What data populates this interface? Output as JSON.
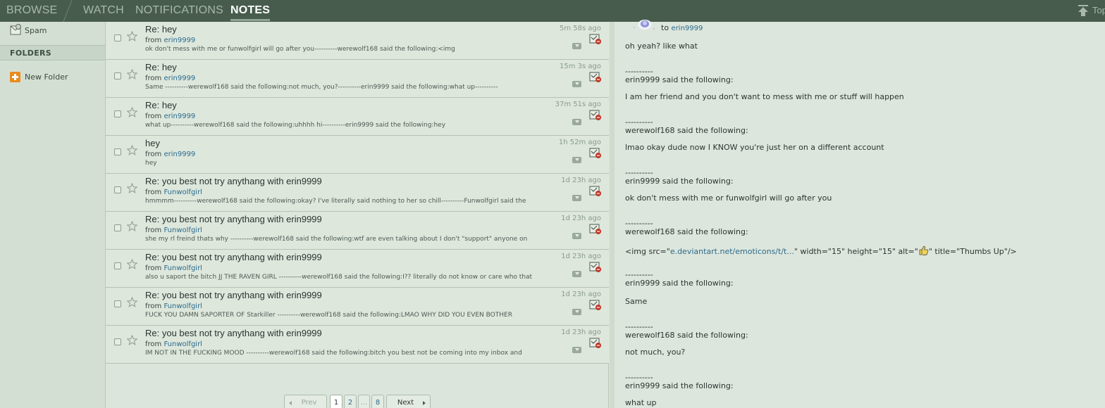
{
  "nav": {
    "tabs": [
      "BROWSE",
      "WATCH",
      "NOTIFICATIONS",
      "NOTES"
    ],
    "active_tab": "NOTES",
    "top_label": "Top"
  },
  "sidebar": {
    "spam_label": "Spam",
    "folders_header": "FOLDERS",
    "new_folder_label": "New Folder"
  },
  "messages": [
    {
      "subject": "Re: hey",
      "from_label": "from",
      "from": "erin9999",
      "time": "5m 58s ago",
      "preview": "ok don't mess with me or funwolfgirl will go after you----------werewolf168 said the following:<img"
    },
    {
      "subject": "Re: hey",
      "from_label": "from",
      "from": "erin9999",
      "time": "15m 3s ago",
      "preview": "Same ----------werewolf168 said the following:not much, you?----------erin9999 said the following:what up----------"
    },
    {
      "subject": "Re: hey",
      "from_label": "from",
      "from": "erin9999",
      "time": "37m 51s ago",
      "preview": "what up----------werewolf168 said the following:uhhhh hi----------erin9999 said the following:hey"
    },
    {
      "subject": "hey",
      "from_label": "from",
      "from": "erin9999",
      "time": "1h 52m ago",
      "preview": "hey"
    },
    {
      "subject": "Re: you best not try anythang with erin9999",
      "from_label": "from",
      "from": "Funwolfgirl",
      "time": "1d 23h ago",
      "preview": "hmmmm----------werewolf168 said the following:okay? I've literally said nothing to her so chill----------Funwolfgirl said the"
    },
    {
      "subject": "Re: you best not try anythang with erin9999",
      "from_label": "from",
      "from": "Funwolfgirl",
      "time": "1d 23h ago",
      "preview": "she my rl freind thats why ----------werewolf168 said the following:wtf are even talking about I don't \"support\" anyone on"
    },
    {
      "subject": "Re: you best not try anythang with erin9999",
      "from_label": "from",
      "from": "Funwolfgirl",
      "time": "1d 23h ago",
      "preview": "also u saport the bitch JJ THE RAVEN GIRL ----------werewolf168 said the following:I?? literally do not know or care who that"
    },
    {
      "subject": "Re: you best not try anythang with erin9999",
      "from_label": "from",
      "from": "Funwolfgirl",
      "time": "1d 23h ago",
      "preview": "FUCK YOU DAMN SAPORTER OF Starkiller ----------werewolf168 said the following:LMAO WHY DID YOU EVEN BOTHER"
    },
    {
      "subject": "Re: you best not try anythang with erin9999",
      "from_label": "from",
      "from": "Funwolfgirl",
      "time": "1d 23h ago",
      "preview": "IM NOT IN THE FUCKING MOOD ----------werewolf168 said the following:bitch you best not be coming into my inbox and"
    }
  ],
  "pagination": {
    "prev": "Prev",
    "pages": [
      "1",
      "2",
      "...",
      "8"
    ],
    "current": "1",
    "next": "Next"
  },
  "note": {
    "to_label": "to",
    "recipient": "erin9999",
    "lines": [
      {
        "text": "oh yeah? like what"
      },
      {
        "text": "----------"
      },
      {
        "text": "erin9999 said the following:"
      },
      {
        "text": "I am her friend and you don't want to mess with me or stuff will happen"
      },
      {
        "text": "----------"
      },
      {
        "text": "werewolf168 said the following:"
      },
      {
        "text": "lmao okay dude now I KNOW you're just her on a different account"
      },
      {
        "text": "----------"
      },
      {
        "text": "erin9999 said the following:"
      },
      {
        "text": "ok don't mess with me or funwolfgirl will go after you"
      },
      {
        "text": "----------"
      },
      {
        "text": "werewolf168 said the following:"
      },
      {
        "pre": "<img src=\"",
        "link": "e.deviantart.net/emoticons/t/t...",
        "post": "\" width=\"15\" height=\"15\" alt=\"",
        "post2": "\" title=\"Thumbs Up\"/>"
      },
      {
        "text": "----------"
      },
      {
        "text": "erin9999 said the following:"
      },
      {
        "text": "Same"
      },
      {
        "text": "----------"
      },
      {
        "text": "werewolf168 said the following:"
      },
      {
        "text": "not much, you?"
      },
      {
        "text": "----------"
      },
      {
        "text": "erin9999 said the following:"
      },
      {
        "text": "what up"
      }
    ]
  }
}
